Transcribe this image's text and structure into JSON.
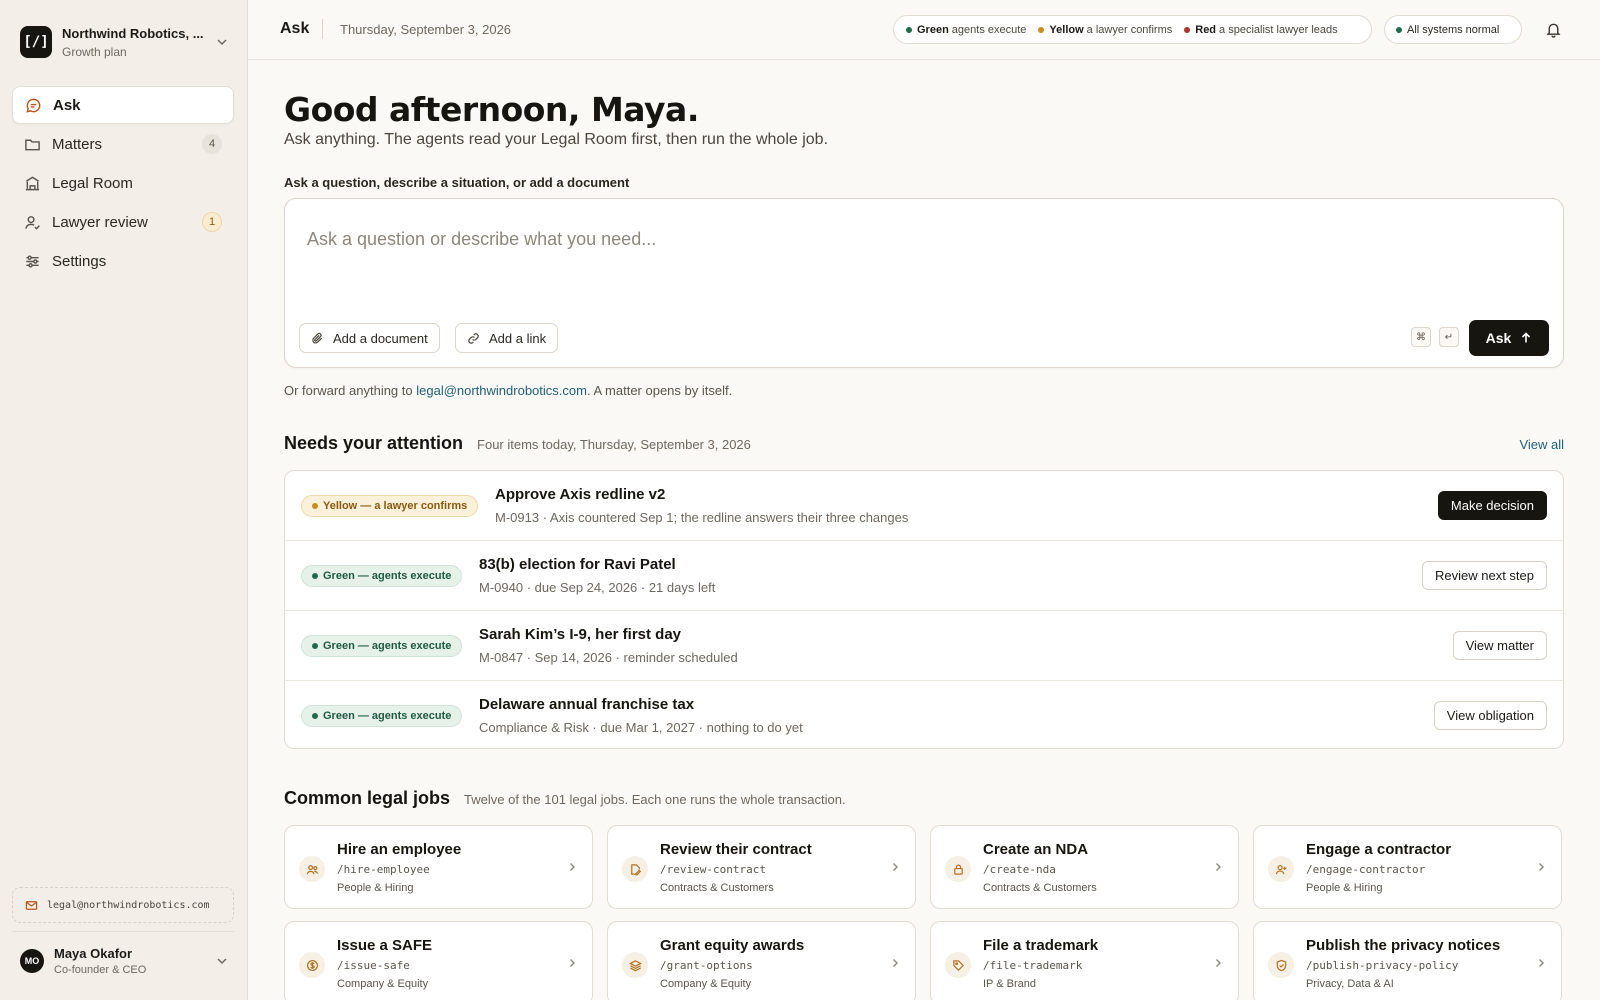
{
  "workspace": {
    "name": "Northwind Robotics, ...",
    "plan": "Growth plan",
    "logo_text": "[/]"
  },
  "nav": [
    {
      "label": "Ask",
      "icon": "chat-bubble-icon",
      "count": null,
      "active": true
    },
    {
      "label": "Matters",
      "icon": "folder-icon",
      "count": "4",
      "active": false
    },
    {
      "label": "Legal Room",
      "icon": "building-icon",
      "count": null,
      "active": false
    },
    {
      "label": "Lawyer review",
      "icon": "person-check-icon",
      "count": "1",
      "active": false
    },
    {
      "label": "Settings",
      "icon": "sliders-icon",
      "count": null,
      "active": false
    }
  ],
  "sidebar_email": "legal@northwindrobotics.com",
  "user": {
    "initials": "MO",
    "name": "Maya Okafor",
    "role": "Co-founder & CEO"
  },
  "topbar": {
    "title": "Ask",
    "date": "Thursday, September 3, 2026",
    "legend": [
      {
        "level": "Green",
        "text": "agents execute",
        "color": "#1f6b4c"
      },
      {
        "level": "Yellow",
        "text": "a lawyer confirms",
        "color": "#c98a1e"
      },
      {
        "level": "Red",
        "text": "a specialist lawyer leads",
        "color": "#b0352a"
      }
    ],
    "status": "All systems normal"
  },
  "greeting": "Good afternoon, Maya.",
  "subtitle": "Ask anything. The agents read your Legal Room first, then run the whole job.",
  "ask": {
    "label": "Ask a question, describe a situation, or add a document",
    "placeholder": "Ask a question or describe what you need...",
    "add_document": "Add a document",
    "add_link": "Add a link",
    "kbd_cmd": "⌘",
    "kbd_enter": "↵",
    "submit": "Ask"
  },
  "forward": {
    "prefix": "Or forward anything to ",
    "email": "legal@northwindrobotics.com",
    "suffix": ". A matter opens by itself."
  },
  "attention": {
    "title": "Needs your attention",
    "note": "Four items today, Thursday, September 3, 2026",
    "view_all": "View all",
    "items": [
      {
        "badge": "Yellow — a lawyer confirms",
        "tone": "yellow",
        "title": "Approve Axis redline v2",
        "meta": "M-0913 · Axis countered Sep 1; the redline answers their three changes",
        "action": "Make decision",
        "primary": true
      },
      {
        "badge": "Green — agents execute",
        "tone": "green",
        "title": "83(b) election for Ravi Patel",
        "meta": "M-0940 · due Sep 24, 2026 · 21 days left",
        "action": "Review next step",
        "primary": false
      },
      {
        "badge": "Green — agents execute",
        "tone": "green",
        "title": "Sarah Kim’s I-9, her first day",
        "meta": "M-0847 · Sep 14, 2026 · reminder scheduled",
        "action": "View matter",
        "primary": false
      },
      {
        "badge": "Green — agents execute",
        "tone": "green",
        "title": "Delaware annual franchise tax",
        "meta": "Compliance & Risk · due Mar 1, 2027 · nothing to do yet",
        "action": "View obligation",
        "primary": false
      }
    ]
  },
  "jobs": {
    "title": "Common legal jobs",
    "note": "Twelve of the 101 legal jobs. Each one runs the whole transaction.",
    "items": [
      {
        "title": "Hire an employee",
        "cmd": "/hire-employee",
        "category": "People & Hiring",
        "icon": "people-icon"
      },
      {
        "title": "Review their contract",
        "cmd": "/review-contract",
        "category": "Contracts & Customers",
        "icon": "document-edit-icon"
      },
      {
        "title": "Create an NDA",
        "cmd": "/create-nda",
        "category": "Contracts & Customers",
        "icon": "lock-icon"
      },
      {
        "title": "Engage a contractor",
        "cmd": "/engage-contractor",
        "category": "People & Hiring",
        "icon": "person-add-icon"
      },
      {
        "title": "Issue a SAFE",
        "cmd": "/issue-safe",
        "category": "Company & Equity",
        "icon": "dollar-coin-icon"
      },
      {
        "title": "Grant equity awards",
        "cmd": "/grant-options",
        "category": "Company & Equity",
        "icon": "layers-icon"
      },
      {
        "title": "File a trademark",
        "cmd": "/file-trademark",
        "category": "IP & Brand",
        "icon": "tag-icon"
      },
      {
        "title": "Publish the privacy notices",
        "cmd": "/publish-privacy-policy",
        "category": "Privacy, Data & AI",
        "icon": "shield-check-icon"
      }
    ]
  }
}
